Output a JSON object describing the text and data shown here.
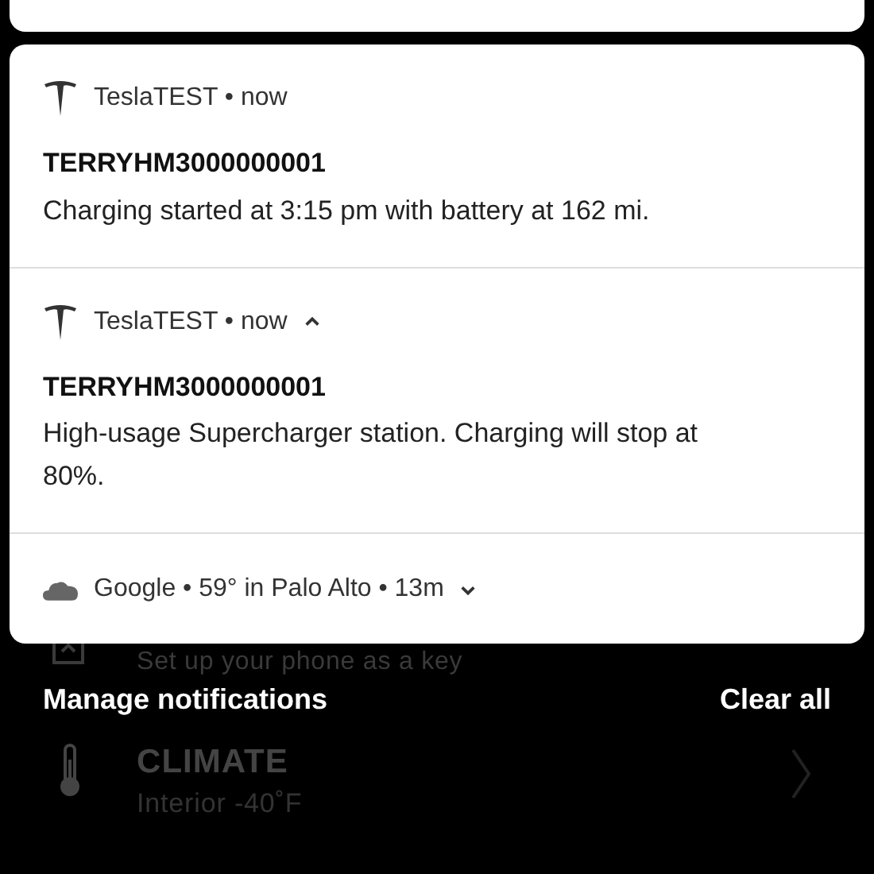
{
  "background_app": {
    "key_row": {
      "label": "Set up your phone as a key"
    },
    "climate_row": {
      "title": "CLIMATE",
      "subtitle": "Interior -40˚F"
    }
  },
  "notifications": [
    {
      "kind": "app",
      "header": "TeslaTEST • now",
      "title": "TERRYHM3000000001",
      "body": "Charging started at 3:15 pm with battery at 162 mi."
    },
    {
      "kind": "app",
      "header": "TeslaTEST • now",
      "expanded": true,
      "title": "TERRYHM3000000001",
      "body": "High-usage Supercharger station. Charging will stop at 80%."
    },
    {
      "kind": "weather",
      "header": "Google • 59° in Palo Alto • 13m",
      "expanded": false
    }
  ],
  "footer": {
    "manage": "Manage notifications",
    "clear": "Clear all"
  }
}
